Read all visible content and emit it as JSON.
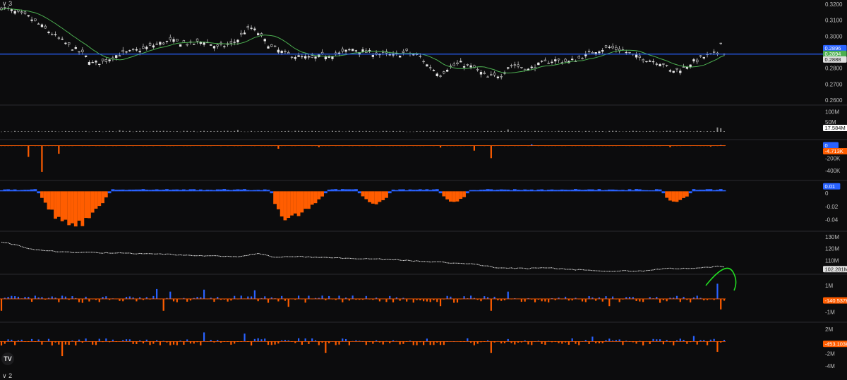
{
  "corner_labels": {
    "top": "∨ 3",
    "bottom": "∨ 2"
  },
  "logo_text": "TV",
  "colors": {
    "background": "#0c0c0d",
    "blue": "#2962ff",
    "orange": "#ff5d00",
    "green": "#4caf50",
    "white": "#e8e8e8",
    "annotation": "#22dd22",
    "separator": "#2a2a2e"
  },
  "chart_data": [
    {
      "type": "candlestick",
      "pane": "price",
      "ylim": [
        0.26,
        0.32
      ],
      "ticks": [
        "0.3200",
        "0.3100",
        "0.3000",
        "0.2900",
        "0.2800",
        "0.2700",
        "0.2600"
      ],
      "tick_values": [
        0.32,
        0.31,
        0.3,
        0.29,
        0.28,
        0.27,
        0.26
      ],
      "horizontal_line": 0.2888,
      "moving_average": "green",
      "tags": [
        {
          "text": "0.2896",
          "value": 0.2896,
          "color": "#2962ff"
        },
        {
          "text": "0.2894",
          "value": 0.2894,
          "color": "#4caf50"
        },
        {
          "text": "0.2888",
          "value": 0.2888,
          "color": "#e0e0e0"
        }
      ],
      "close_path": [
        [
          0,
          0.318
        ],
        [
          4,
          0.315
        ],
        [
          8,
          0.312
        ],
        [
          12,
          0.306
        ],
        [
          16,
          0.3
        ],
        [
          20,
          0.294
        ],
        [
          24,
          0.289
        ],
        [
          27,
          0.283
        ],
        [
          30,
          0.284
        ],
        [
          34,
          0.288
        ],
        [
          38,
          0.29
        ],
        [
          42,
          0.292
        ],
        [
          46,
          0.295
        ],
        [
          50,
          0.297
        ],
        [
          53,
          0.296
        ],
        [
          56,
          0.295
        ],
        [
          60,
          0.297
        ],
        [
          64,
          0.293
        ],
        [
          68,
          0.295
        ],
        [
          70,
          0.298
        ],
        [
          72,
          0.303
        ],
        [
          74,
          0.305
        ],
        [
          76,
          0.302
        ],
        [
          78,
          0.297
        ],
        [
          80,
          0.293
        ],
        [
          84,
          0.289
        ],
        [
          88,
          0.287
        ],
        [
          92,
          0.286
        ],
        [
          96,
          0.288
        ],
        [
          100,
          0.289
        ],
        [
          104,
          0.292
        ],
        [
          108,
          0.29
        ],
        [
          112,
          0.289
        ],
        [
          116,
          0.288
        ],
        [
          120,
          0.29
        ],
        [
          124,
          0.287
        ],
        [
          126,
          0.282
        ],
        [
          128,
          0.279
        ],
        [
          130,
          0.276
        ],
        [
          132,
          0.28
        ],
        [
          136,
          0.283
        ],
        [
          140,
          0.28
        ],
        [
          144,
          0.274
        ],
        [
          148,
          0.276
        ],
        [
          150,
          0.281
        ],
        [
          152,
          0.282
        ],
        [
          156,
          0.279
        ],
        [
          160,
          0.283
        ],
        [
          164,
          0.285
        ],
        [
          168,
          0.284
        ],
        [
          172,
          0.287
        ],
        [
          176,
          0.291
        ],
        [
          180,
          0.293
        ],
        [
          184,
          0.291
        ],
        [
          188,
          0.287
        ],
        [
          192,
          0.285
        ],
        [
          196,
          0.283
        ],
        [
          198,
          0.278
        ],
        [
          202,
          0.28
        ],
        [
          204,
          0.283
        ],
        [
          208,
          0.287
        ],
        [
          212,
          0.289
        ],
        [
          213,
          0.297
        ],
        [
          214,
          0.289
        ]
      ],
      "point_count": 215
    },
    {
      "type": "bar",
      "pane": "volume",
      "ticks": [
        "100M",
        "50M"
      ],
      "tick_values": [
        100,
        50
      ],
      "ylim": [
        0,
        130
      ],
      "tags": [
        {
          "text": "17.584M",
          "value": 17.584,
          "color": "#ffffff"
        }
      ],
      "spikes": [
        [
          212,
          22
        ],
        [
          213,
          18
        ],
        [
          150,
          12
        ],
        [
          35,
          8
        ],
        [
          70,
          9
        ]
      ]
    },
    {
      "type": "bar",
      "pane": "delta-1",
      "ticks": [
        "0",
        "-200K",
        "-400K"
      ],
      "tick_values": [
        0,
        -200,
        -400
      ],
      "ylim": [
        -500,
        40
      ],
      "tags": [
        {
          "text": "0",
          "value": 0,
          "color": "#2962ff"
        },
        {
          "text": "-4.713K",
          "value": -4.713,
          "color": "#ff5d00"
        }
      ],
      "spikes": [
        [
          8,
          -180
        ],
        [
          12,
          -420
        ],
        [
          17,
          -130
        ],
        [
          82,
          -50
        ],
        [
          94,
          -25
        ],
        [
          130,
          -30
        ],
        [
          140,
          -80
        ],
        [
          145,
          -200
        ],
        [
          157,
          22
        ],
        [
          198,
          -25
        ],
        [
          210,
          -15
        ],
        [
          213,
          10
        ]
      ]
    },
    {
      "type": "area-bar",
      "pane": "oscillator",
      "ticks": [
        "0.01",
        "0",
        "-0.02",
        "-0.04"
      ],
      "tick_values": [
        0.01,
        0,
        -0.02,
        -0.04
      ],
      "ylim": [
        -0.052,
        0.014
      ],
      "tags": [
        {
          "text": "0.01",
          "value": 0.01,
          "color": "#2962ff"
        }
      ],
      "dips": [
        [
          11,
          21,
          32,
          -0.048
        ],
        [
          80,
          84,
          96,
          -0.038
        ],
        [
          106,
          111,
          115,
          -0.016
        ],
        [
          130,
          134,
          138,
          -0.014
        ],
        [
          196,
          199,
          204,
          -0.014
        ]
      ]
    },
    {
      "type": "line",
      "pane": "cumulative",
      "ticks": [
        "130M",
        "120M",
        "110M"
      ],
      "tick_values": [
        130,
        120,
        110
      ],
      "ylim": [
        100,
        133
      ],
      "tags": [
        {
          "text": "102.281M",
          "value": 102.281,
          "color": "#e0e0e0"
        }
      ],
      "path": [
        [
          0,
          126
        ],
        [
          10,
          119
        ],
        [
          20,
          117
        ],
        [
          36,
          116
        ],
        [
          50,
          115
        ],
        [
          60,
          114
        ],
        [
          70,
          113
        ],
        [
          76,
          116
        ],
        [
          80,
          113
        ],
        [
          90,
          113
        ],
        [
          100,
          112
        ],
        [
          112,
          111
        ],
        [
          120,
          110
        ],
        [
          132,
          108
        ],
        [
          140,
          107
        ],
        [
          146,
          104
        ],
        [
          156,
          103
        ],
        [
          160,
          104
        ],
        [
          170,
          102
        ],
        [
          180,
          101
        ],
        [
          190,
          101
        ],
        [
          196,
          103
        ],
        [
          205,
          103
        ],
        [
          213,
          105
        ],
        [
          214,
          104
        ]
      ]
    },
    {
      "type": "bar",
      "pane": "delta-2",
      "ticks": [
        "1M",
        "-1M"
      ],
      "tick_values": [
        1,
        -1
      ],
      "ylim": [
        -1.5,
        1.6
      ],
      "tags": [
        {
          "text": "-140.537K",
          "value": -0.140537,
          "color": "#ff5d00"
        }
      ],
      "spikes": [
        [
          46,
          0.75
        ],
        [
          50,
          0.55
        ],
        [
          60,
          0.7
        ],
        [
          75,
          0.65
        ],
        [
          0,
          -0.9
        ],
        [
          48,
          -0.9
        ],
        [
          85,
          -0.6
        ],
        [
          145,
          -0.9
        ],
        [
          150,
          0.55
        ],
        [
          212,
          1.15
        ],
        [
          213,
          -0.8
        ],
        [
          130,
          -0.55
        ],
        [
          180,
          -0.55
        ]
      ],
      "annotation": "green-arc"
    },
    {
      "type": "bar",
      "pane": "delta-3",
      "ticks": [
        "2M",
        "-2M",
        "-4M"
      ],
      "tick_values": [
        2,
        -2,
        -4
      ],
      "ylim": [
        -4.6,
        2.6
      ],
      "tags": [
        {
          "text": "-453.103K",
          "value": -0.453103,
          "color": "#ff5d00"
        }
      ],
      "spikes": [
        [
          18,
          -2.4
        ],
        [
          60,
          1.5
        ],
        [
          72,
          1.3
        ],
        [
          96,
          -1.9
        ],
        [
          145,
          -1.9
        ],
        [
          175,
          0.8
        ],
        [
          205,
          0.9
        ],
        [
          212,
          -1.7
        ]
      ]
    }
  ]
}
